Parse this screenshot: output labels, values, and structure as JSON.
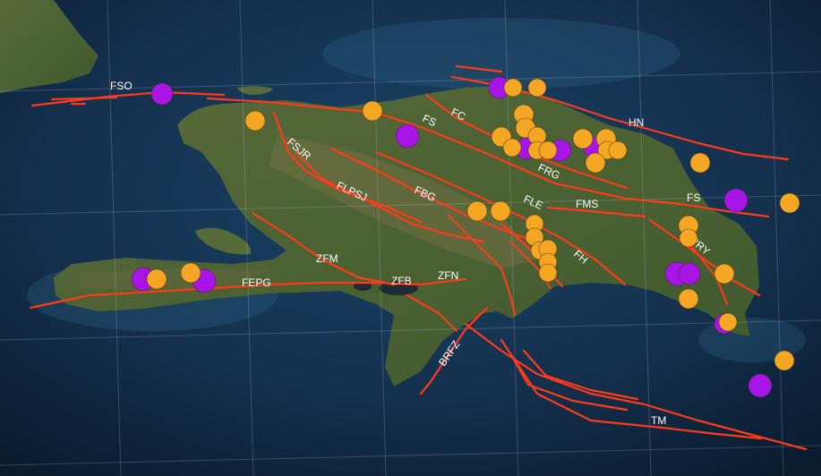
{
  "map": {
    "colors": {
      "ocean": "#13314f",
      "ocean_deep": "#0b1e33",
      "land": "#4a5d34",
      "land_light": "#6b7044",
      "fault": "#ff3a1a",
      "event_orange": "#f5a623",
      "event_purple": "#a614e6",
      "grid": "#c8d8e8",
      "label": "#ffffff"
    },
    "fault_labels": {
      "fso": "FSO",
      "fs_north": "FS",
      "fc": "FC",
      "fsjr": "FSJR",
      "hn": "HN",
      "frg": "FRG",
      "flpsj": "FLPSJ",
      "fbg": "FBG",
      "fle": "FLE",
      "fms": "FMS",
      "fs_east": "FS",
      "pry": "PRY",
      "fh": "FH",
      "zfm": "ZFM",
      "fepg": "FEPG",
      "zfb": "ZFB",
      "zfn": "ZFN",
      "brfz": "BRFZ",
      "tm": "TM"
    },
    "event_legend": {
      "orange": "orange-event-marker",
      "purple": "purple-event-marker"
    }
  }
}
